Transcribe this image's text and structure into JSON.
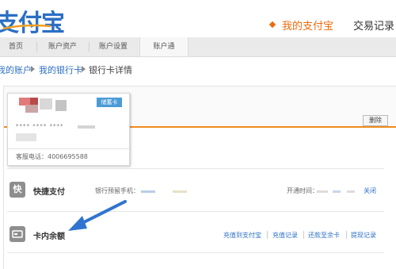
{
  "header": {
    "logo_text": "支付宝",
    "nav_mine": "我的支付宝",
    "nav_trade": "交易记录"
  },
  "subnav": {
    "tabs": [
      {
        "label": "首页"
      },
      {
        "label": "账户资产"
      },
      {
        "label": "账户设置"
      },
      {
        "label": "账户通"
      }
    ]
  },
  "breadcrumb": {
    "items": [
      "我的账户",
      "我的银行卡",
      "银行卡详情"
    ]
  },
  "card": {
    "badge": "储蓄卡",
    "masked_number": "**** **** ****",
    "phone": "客服电话：4006695588",
    "unbind_label": "删除"
  },
  "quick_pay": {
    "title": "快捷支付",
    "icon_char": "快",
    "phone_label": "银行预留手机：",
    "open_time_label": "开通时间：",
    "close_link": "关闭"
  },
  "balance": {
    "title": "卡内余额",
    "links": [
      "充值到支付宝",
      "充值记录",
      "还款至余卡",
      "提现记录"
    ]
  },
  "colors": {
    "brand_blue": "#2b6fc4",
    "accent_orange": "#f06a0b",
    "arrow_blue": "#2f74d0"
  }
}
